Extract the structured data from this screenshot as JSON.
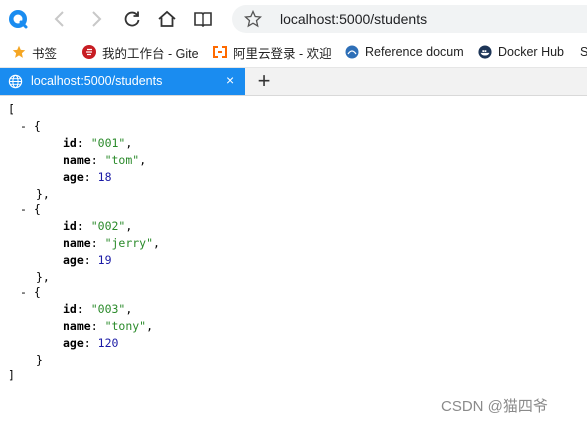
{
  "nav": {
    "address": "localhost:5000/students"
  },
  "bookmarks": [
    {
      "label": "书签",
      "icon": "star-icon"
    },
    {
      "label": "我的工作台 - Gite",
      "icon": "gitee-icon"
    },
    {
      "label": "阿里云登录 - 欢迎",
      "icon": "aliyun-icon"
    },
    {
      "label": "Reference docum",
      "icon": "reference-icon"
    },
    {
      "label": "Docker Hub",
      "icon": "docker-icon"
    },
    {
      "label": "S",
      "icon": "generic-icon"
    }
  ],
  "tab": {
    "title": "localhost:5000/students",
    "close": "×",
    "new_tab": "+"
  },
  "json_view": {
    "open_bracket": "[",
    "close_bracket": "]",
    "records": [
      {
        "id": "\"001\"",
        "name": "\"tom\"",
        "age": "18"
      },
      {
        "id": "\"002\"",
        "name": "\"jerry\"",
        "age": "19"
      },
      {
        "id": "\"003\"",
        "name": "\"tony\"",
        "age": "120"
      }
    ],
    "keys": {
      "id": "id",
      "name": "name",
      "age": "age"
    }
  },
  "watermark": "CSDN @猫四爷",
  "colors": {
    "tab_active": "#1a8cf0",
    "string": "#2a8a2a",
    "number": "#1a1aa6"
  }
}
